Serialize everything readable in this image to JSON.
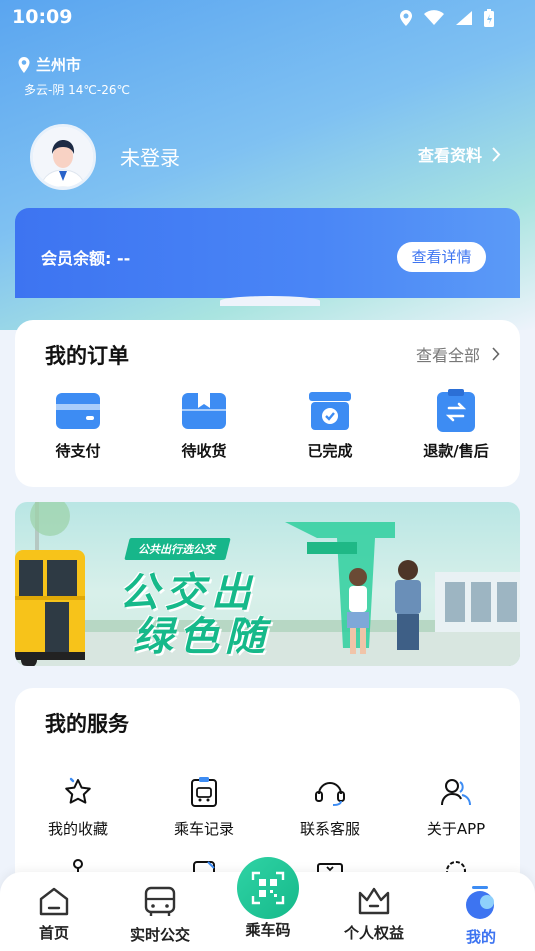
{
  "status_bar": {
    "time": "10:09"
  },
  "location": {
    "city": "兰州市",
    "weather": "多云-阴 14℃-26℃"
  },
  "profile": {
    "login_status": "未登录",
    "view_profile": "查看资料"
  },
  "member": {
    "balance_label": "会员余额: --",
    "details_button": "查看详情"
  },
  "orders": {
    "title": "我的订单",
    "view_all": "查看全部",
    "items": [
      {
        "label": "待支付",
        "icon": "wallet-icon"
      },
      {
        "label": "待收货",
        "icon": "package-icon"
      },
      {
        "label": "已完成",
        "icon": "completed-box-icon"
      },
      {
        "label": "退款/售后",
        "icon": "refund-icon"
      }
    ]
  },
  "banner": {
    "tag": "公共出行选公交",
    "line1": "公交出",
    "line2": "绿色随"
  },
  "services": {
    "title": "我的服务",
    "items": [
      {
        "label": "我的收藏",
        "icon": "star-icon"
      },
      {
        "label": "乘车记录",
        "icon": "bus-record-icon"
      },
      {
        "label": "联系客服",
        "icon": "headset-icon"
      },
      {
        "label": "关于APP",
        "icon": "about-icon"
      }
    ]
  },
  "tabbar": {
    "home": "首页",
    "realtime_bus": "实时公交",
    "ride_code": "乘车码",
    "benefits": "个人权益",
    "mine": "我的"
  },
  "colors": {
    "accent_blue": "#3d74f1",
    "accent_green": "#16b98a"
  }
}
